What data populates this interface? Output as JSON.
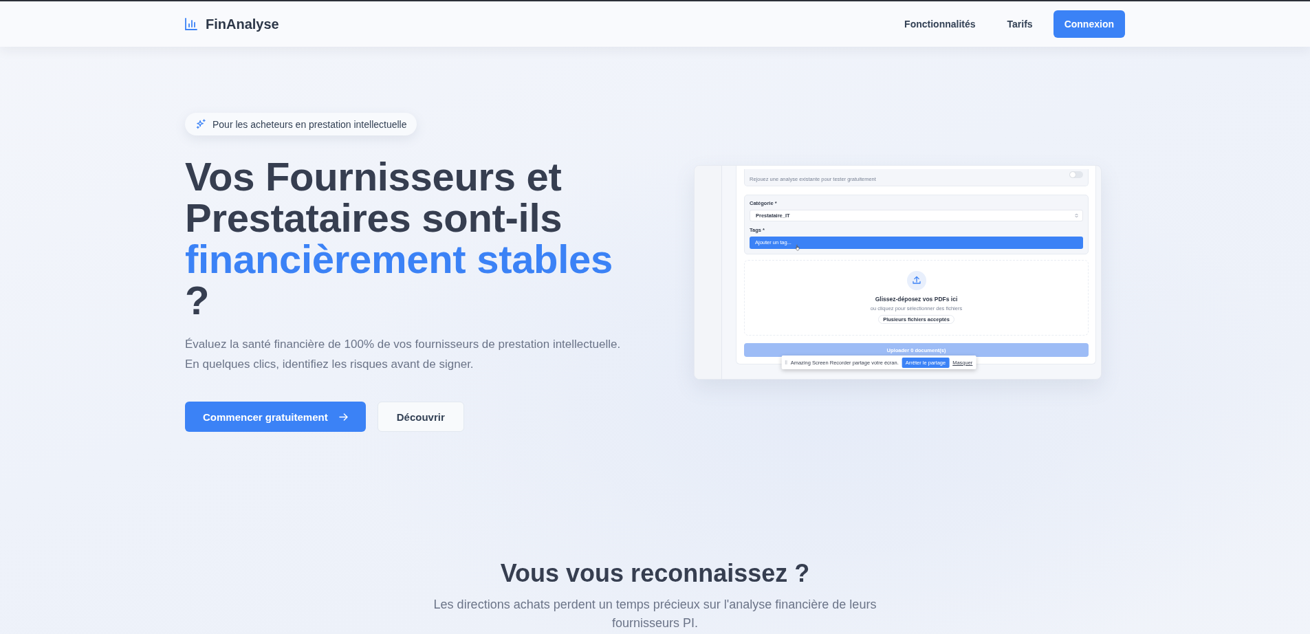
{
  "header": {
    "logo": "FinAnalyse",
    "nav": [
      {
        "label": "Fonctionnalités",
        "kind": "link"
      },
      {
        "label": "Tarifs",
        "kind": "link"
      },
      {
        "label": "Connexion",
        "kind": "button"
      }
    ]
  },
  "hero": {
    "badge": "Pour les acheteurs en prestation intellectuelle",
    "title": "Vos Fournisseurs et Prestataires sont-ils",
    "title_highlight": "financièrement stables",
    "title_end": "?",
    "description": [
      "Évaluez la santé financière de 100% de vos fournisseurs de prestation intellectuelle.",
      "En quelques clics, identifiez les risques avant de signer."
    ],
    "actions": [
      {
        "label": "Commencer gratuitement",
        "kind": "primary"
      },
      {
        "label": "Découvrir",
        "kind": "secondary"
      }
    ]
  },
  "preview": {
    "test_mode": {
      "description": "Rejouez une analyse existante pour tester gratuitement",
      "on": false
    },
    "category": {
      "label": "Catégorie *",
      "value": "Prestataire_IT"
    },
    "tags": {
      "label": "Tags *",
      "placeholder": "Ajouter un tag...",
      "highlighted": true
    },
    "dropzone": {
      "title": "Glissez-déposez vos PDFs ici",
      "subtitle": "ou cliquez pour sélectionner des fichiers",
      "note": "Plusieurs fichiers acceptés"
    },
    "upload_button": {
      "label": "Uploader 0 document(s)",
      "disabled": true
    },
    "share_bar": {
      "message": "Amazing Screen Recorder partage votre écran.",
      "stop_button": "Arrêter le partage",
      "hide_link": "Masquer"
    }
  },
  "section": {
    "title": "Vous vous reconnaissez ?",
    "subtitle": "Les directions achats perdent un temps précieux sur l'analyse financière de leurs fournisseurs PI."
  }
}
